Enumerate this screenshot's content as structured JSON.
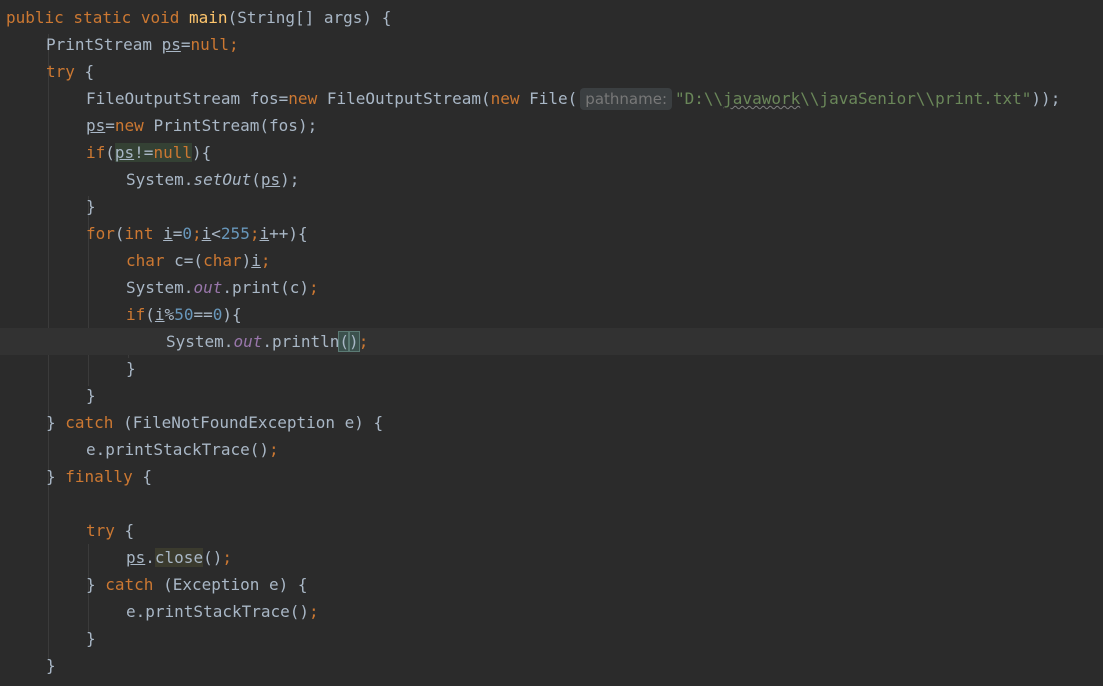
{
  "editor": {
    "hint_label": "pathname:",
    "path_string": "\"D:\\\\javawork\\\\javaSenior\\\\print.txt\"",
    "lines": {
      "l1": {
        "kw": "public static void ",
        "fn": "main",
        "rest": "(String[] args) {"
      },
      "l2": {
        "type": "PrintStream ",
        "var": "ps",
        "op": "=",
        "kw": "null",
        "semi": ";"
      },
      "l3": {
        "kw": "try",
        "rest": " {"
      },
      "l4": {
        "a": "FileOutputStream fos=",
        "kw1": "new",
        "b": " FileOutputStream(",
        "kw2": "new",
        "c": " File(",
        "d": "));"
      },
      "l5": {
        "var": "ps",
        "op": "=",
        "kw": "new",
        "rest": " PrintStream(fos);"
      },
      "l6": {
        "kw": "if",
        "a": "(",
        "var": "ps",
        "b": "!=",
        "nul": "null",
        "c": "){"
      },
      "l7": {
        "a": "System.",
        "m": "setOut",
        "b": "(",
        "var": "ps",
        "c": ");"
      },
      "l8": {
        "a": "}"
      },
      "l9": {
        "kw": "for",
        "a": "(",
        "kw2": "int ",
        "v1": "i",
        "b": "=",
        "n0": "0",
        "s1": ";",
        "v2": "i",
        "c": "<",
        "n1": "255",
        "s2": ";",
        "v3": "i",
        "d": "++){"
      },
      "l10": {
        "kw": "char",
        "a": " c=(",
        "kw2": "char",
        "b": ")",
        "var": "i",
        "c": ";"
      },
      "l11": {
        "a": "System.",
        "fld": "out",
        "b": ".print(c)",
        "c": ";"
      },
      "l12": {
        "kw": "if",
        "a": "(",
        "var": "i",
        "b": "%",
        "n1": "50",
        "c": "==",
        "n2": "0",
        "d": "){"
      },
      "l13": {
        "a": "System.",
        "fld": "out",
        "b": ".println",
        "p1": "(",
        "p2": ")",
        "c": ";"
      },
      "l14": {
        "a": "}"
      },
      "l15": {
        "a": "}"
      },
      "l16": {
        "a": "} ",
        "kw": "catch",
        "b": " (FileNotFoundException e) {"
      },
      "l17": {
        "a": "e.printStackTrace()",
        "b": ";"
      },
      "l18": {
        "a": "} ",
        "kw": "finally",
        "b": " {"
      },
      "l19": {
        "kw": "try",
        "a": " {"
      },
      "l20": {
        "var": "ps",
        "a": ".",
        "m": "close",
        "b": "()",
        "c": ";"
      },
      "l21": {
        "a": "} ",
        "kw": "catch",
        "b": " (Exception e) {"
      },
      "l22": {
        "a": "e.printStackTrace()",
        "b": ";"
      },
      "l23": {
        "a": "}"
      },
      "l24": {
        "a": "}"
      }
    }
  },
  "colors": {
    "background": "#2b2b2b",
    "keyword": "#cc7832",
    "method_decl": "#ffc66d",
    "number": "#6897bb",
    "string": "#6a8759",
    "field": "#9876aa",
    "text": "#a9b7c6"
  }
}
